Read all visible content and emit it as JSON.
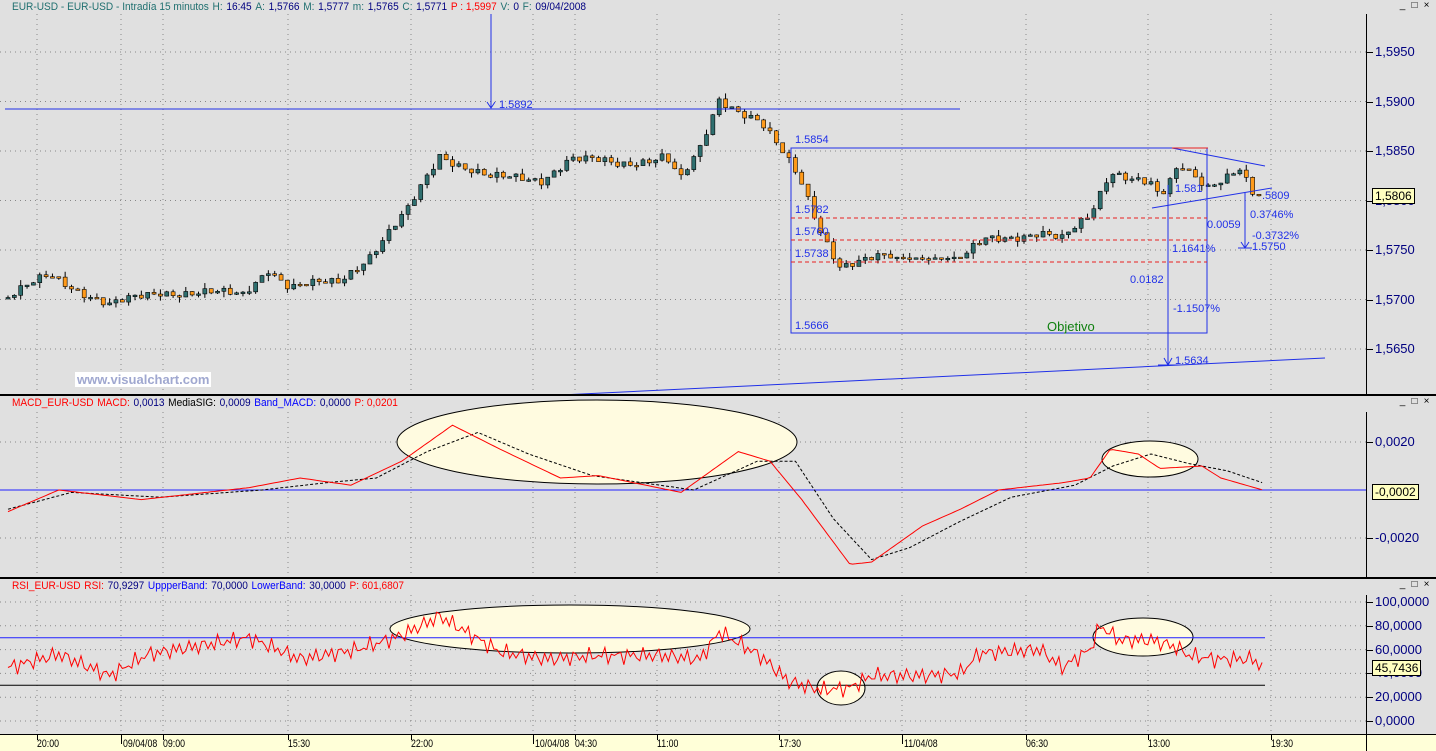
{
  "price_panel": {
    "header": [
      {
        "t": "EUR-USD - EUR-USD - Intradía 15 minutos",
        "c": "#207070"
      },
      {
        "t": "H:",
        "c": "#207070"
      },
      {
        "t": "16:45",
        "c": "#000080"
      },
      {
        "t": "A:",
        "c": "#207070"
      },
      {
        "t": "1,5766",
        "c": "#000080"
      },
      {
        "t": "M:",
        "c": "#207070"
      },
      {
        "t": "1,5777",
        "c": "#000080"
      },
      {
        "t": "m:",
        "c": "#207070"
      },
      {
        "t": "1,5765",
        "c": "#000080"
      },
      {
        "t": "C:",
        "c": "#207070"
      },
      {
        "t": "1,5771",
        "c": "#000080"
      },
      {
        "t": "P : 1,5997",
        "c": "#ff0000"
      },
      {
        "t": "V:",
        "c": "#207070"
      },
      {
        "t": "0",
        "c": "#000080"
      },
      {
        "t": "F:",
        "c": "#207070"
      },
      {
        "t": "09/04/2008",
        "c": "#000080"
      }
    ],
    "axis_labels": [
      {
        "v": 1.595,
        "t": "1,5950"
      },
      {
        "v": 1.59,
        "t": "1,5900"
      },
      {
        "v": 1.585,
        "t": "1,5850"
      },
      {
        "v": 1.58,
        "t": "1,5800"
      },
      {
        "v": 1.575,
        "t": "1,5750"
      },
      {
        "v": 1.57,
        "t": "1,5700"
      },
      {
        "v": 1.565,
        "t": "1,5650"
      }
    ],
    "last_price": "1,5806",
    "watermark": "www.visualchart.com",
    "annotations": {
      "l1": "1.5892",
      "l2": "1.5854",
      "l3": "1.5782",
      "l4": "1.5760",
      "l5": "1.5738",
      "l6": "1.5666",
      "l7": "Objetivo",
      "l8": "1.5634",
      "l9": "-1.1507%",
      "l10": "0.0182",
      "l11": "1.1641%",
      "l12": "0.0059",
      "l13": "1.581",
      "l14": ".5809",
      "l15": "0.3746%",
      "l16": "-0.3732%",
      "l17": "1.5750"
    }
  },
  "macd_panel": {
    "header": [
      {
        "t": "MACD_EUR-USD",
        "c": "#ff0000"
      },
      {
        "t": "MACD:",
        "c": "#ff0000"
      },
      {
        "t": "0,0013",
        "c": "#000080"
      },
      {
        "t": "MediaSIG:",
        "c": "#000000"
      },
      {
        "t": "0,0009",
        "c": "#000080"
      },
      {
        "t": "Band_MACD:",
        "c": "#0000ff"
      },
      {
        "t": "0,0000",
        "c": "#000080"
      },
      {
        "t": "P: 0,0201",
        "c": "#ff0000"
      }
    ],
    "axis_labels": [
      {
        "v": 0.002,
        "t": "0,0020"
      },
      {
        "v": -0.002,
        "t": "-0,0020"
      }
    ],
    "last_value": "-0,0002"
  },
  "rsi_panel": {
    "header": [
      {
        "t": "RSI_EUR-USD",
        "c": "#ff0000"
      },
      {
        "t": "RSI:",
        "c": "#ff0000"
      },
      {
        "t": "70,9297",
        "c": "#000080"
      },
      {
        "t": "UppperBand:",
        "c": "#0000ff"
      },
      {
        "t": "70,0000",
        "c": "#000080"
      },
      {
        "t": "LowerBand:",
        "c": "#0000ff"
      },
      {
        "t": "30,0000",
        "c": "#000080"
      },
      {
        "t": "P: 601,6807",
        "c": "#ff0000"
      }
    ],
    "axis_labels": [
      {
        "v": 100,
        "t": "100,0000"
      },
      {
        "v": 80,
        "t": "80,0000"
      },
      {
        "v": 60,
        "t": "60,0000"
      },
      {
        "v": 40,
        "t": "40,0000"
      },
      {
        "v": 20,
        "t": "20,0000"
      },
      {
        "v": 0,
        "t": "0,0000"
      }
    ],
    "last_value": "45,7436"
  },
  "window_buttons": [
    "_",
    "□",
    "×"
  ],
  "x_axis": [
    {
      "t": "20:00",
      "m": 37
    },
    {
      "t": "09/04/08",
      "m": 121,
      "d": 1
    },
    {
      "t": "09:00",
      "m": 163
    },
    {
      "t": "15:30",
      "m": 288
    },
    {
      "t": "22:00",
      "m": 411
    },
    {
      "t": "10/04/08",
      "m": 533,
      "d": 1
    },
    {
      "t": "04:30",
      "m": 575
    },
    {
      "t": "11:00",
      "m": 657
    },
    {
      "t": "17:30",
      "m": 779
    },
    {
      "t": "11/04/08",
      "m": 902,
      "d": 1
    },
    {
      "t": "06:30",
      "m": 1026
    },
    {
      "t": "13:00",
      "m": 1148
    },
    {
      "t": "19:30",
      "m": 1271
    }
  ],
  "chart_data": {
    "type": "candlestick",
    "symbol": "EUR-USD",
    "close_anchors": [
      [
        0,
        1.5702
      ],
      [
        6.6,
        1.5725
      ],
      [
        16,
        1.5694
      ],
      [
        24,
        1.5708
      ],
      [
        37,
        1.5705
      ],
      [
        41,
        1.5732
      ],
      [
        44.4,
        1.5712
      ],
      [
        52,
        1.5718
      ],
      [
        57,
        1.5745
      ],
      [
        63,
        1.579
      ],
      [
        68,
        1.5846
      ],
      [
        76,
        1.5823
      ],
      [
        84,
        1.5821
      ],
      [
        88.5,
        1.5843
      ],
      [
        96.4,
        1.5836
      ],
      [
        103.5,
        1.5846
      ],
      [
        106,
        1.5821
      ],
      [
        109,
        1.5851
      ],
      [
        112,
        1.5902
      ],
      [
        118.4,
        1.5881
      ],
      [
        121.6,
        1.5851
      ],
      [
        124.7,
        1.5821
      ],
      [
        128,
        1.577
      ],
      [
        131,
        1.5735
      ],
      [
        134,
        1.5738
      ],
      [
        137.3,
        1.5742
      ],
      [
        150,
        1.5742
      ],
      [
        154,
        1.576
      ],
      [
        162.5,
        1.5768
      ],
      [
        166,
        1.576
      ],
      [
        170.4,
        1.5785
      ],
      [
        173.6,
        1.5831
      ],
      [
        180,
        1.5816
      ],
      [
        181.4,
        1.58
      ],
      [
        184.6,
        1.5836
      ],
      [
        189,
        1.5816
      ],
      [
        194,
        1.5831
      ],
      [
        196.4,
        1.58
      ],
      [
        197.6,
        1.5806
      ]
    ],
    "macd_anchors": [
      [
        0,
        -0.0009
      ],
      [
        8,
        0
      ],
      [
        21,
        -0.0004
      ],
      [
        38,
        0.0001
      ],
      [
        46,
        0.0005
      ],
      [
        54,
        0.0002
      ],
      [
        62,
        0.0012
      ],
      [
        70,
        0.0027
      ],
      [
        77.5,
        0.0017
      ],
      [
        87,
        0.0005
      ],
      [
        93,
        0.0006
      ],
      [
        106,
        -0.0001
      ],
      [
        115,
        0.0016
      ],
      [
        120,
        0.0012
      ],
      [
        125,
        -0.0004
      ],
      [
        132.6,
        -0.0031
      ],
      [
        136,
        -0.003
      ],
      [
        144,
        -0.0015
      ],
      [
        150,
        -0.0008
      ],
      [
        156,
        0
      ],
      [
        166,
        0.0003
      ],
      [
        170.4,
        0.0005
      ],
      [
        173.6,
        0.0017
      ],
      [
        178,
        0.0015
      ],
      [
        181.4,
        0.0009
      ],
      [
        188,
        0.001
      ],
      [
        191,
        0.0005
      ],
      [
        197.6,
        0
      ]
    ],
    "signal_anchors": [
      [
        0,
        -0.0008
      ],
      [
        10,
        -0.0001
      ],
      [
        24,
        -0.0003
      ],
      [
        40,
        0
      ],
      [
        50,
        0.0003
      ],
      [
        58,
        0.0005
      ],
      [
        66,
        0.0016
      ],
      [
        74,
        0.0024
      ],
      [
        82,
        0.0015
      ],
      [
        92,
        0.0006
      ],
      [
        108,
        0
      ],
      [
        118,
        0.0012
      ],
      [
        124,
        0.0012
      ],
      [
        130,
        -0.0012
      ],
      [
        136,
        -0.0029
      ],
      [
        142,
        -0.0024
      ],
      [
        150,
        -0.0013
      ],
      [
        158,
        -0.0003
      ],
      [
        168,
        0.0002
      ],
      [
        174,
        0.001
      ],
      [
        180,
        0.0015
      ],
      [
        186,
        0.0011
      ],
      [
        192,
        0.0008
      ],
      [
        197.6,
        0.0003
      ]
    ],
    "rsi_anchors": [
      [
        0,
        45
      ],
      [
        8,
        56
      ],
      [
        16,
        38
      ],
      [
        22,
        56
      ],
      [
        38,
        70
      ],
      [
        46,
        52
      ],
      [
        55,
        60
      ],
      [
        62,
        72
      ],
      [
        68,
        88
      ],
      [
        77.5,
        58
      ],
      [
        85,
        52
      ],
      [
        93,
        55
      ],
      [
        103,
        55
      ],
      [
        109,
        52
      ],
      [
        112,
        75
      ],
      [
        118.4,
        55
      ],
      [
        123,
        33
      ],
      [
        128,
        26
      ],
      [
        132.6,
        28
      ],
      [
        136,
        38
      ],
      [
        144,
        38
      ],
      [
        150,
        40
      ],
      [
        153,
        57
      ],
      [
        162.5,
        60
      ],
      [
        166,
        45
      ],
      [
        170.4,
        60
      ],
      [
        172,
        80
      ],
      [
        175,
        68
      ],
      [
        180,
        68
      ],
      [
        184,
        62
      ],
      [
        186,
        55
      ],
      [
        190,
        52
      ],
      [
        196,
        52
      ],
      [
        197.6,
        45
      ]
    ],
    "rsi_bands": [
      70,
      30
    ],
    "macd_band": 0,
    "ylim_price": [
      1.5625,
      1.5975
    ],
    "ylim_macd": [
      -0.0036,
      0.0038
    ],
    "ylim_rsi": [
      -5,
      105
    ]
  }
}
